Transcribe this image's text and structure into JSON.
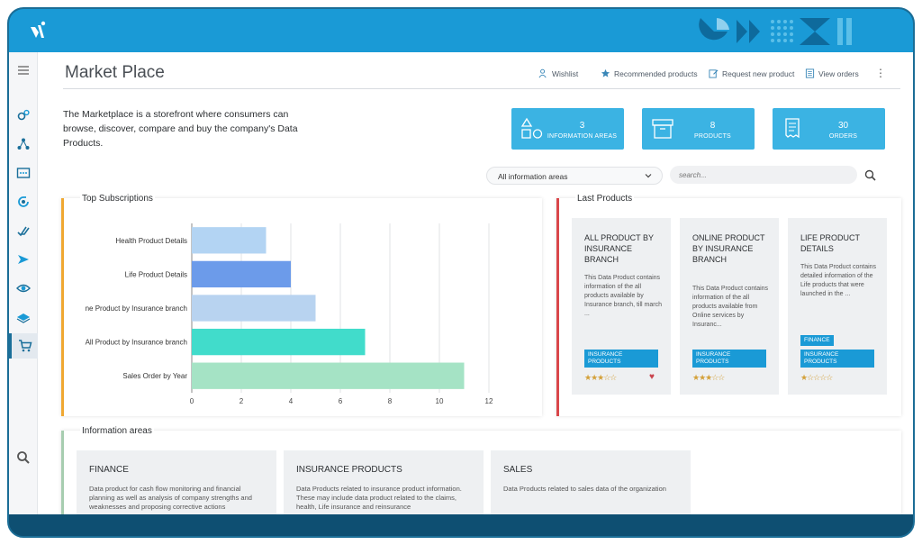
{
  "app": {
    "title": "Market Place"
  },
  "header_actions": [
    {
      "label": "Wishlist",
      "icon": "user-heart-icon"
    },
    {
      "label": "Recommended products",
      "icon": "star-icon"
    },
    {
      "label": "Request new product",
      "icon": "edit-icon"
    },
    {
      "label": "View orders",
      "icon": "list-icon"
    }
  ],
  "intro": "The Marketplace is a storefront where consumers can browse, discover, compare and buy the company's Data Products.",
  "stats": [
    {
      "value": "3",
      "label": "INFORMATION AREAS",
      "icon": "shapes-icon"
    },
    {
      "value": "8",
      "label": "PRODUCTS",
      "icon": "archive-box-icon"
    },
    {
      "value": "30",
      "label": "ORDERS",
      "icon": "receipt-icon"
    }
  ],
  "filters": {
    "select_value": "All information areas",
    "search_placeholder": "search..."
  },
  "top_subscriptions": {
    "title": "Top Subscriptions"
  },
  "chart_data": {
    "type": "bar",
    "orientation": "horizontal",
    "categories": [
      "Health Product Details",
      "Life Product Details",
      "Online Product by Insurance branch",
      "All Product by Insurance branch",
      "Sales Order by Year"
    ],
    "category_labels_shown": [
      "Health Product Details",
      "Life Product Details",
      "ne Product by Insurance branch",
      "All Product by Insurance branch",
      "Sales Order by Year"
    ],
    "values": [
      3,
      4,
      5,
      7,
      11
    ],
    "bar_colors": [
      "#b3d4f3",
      "#6c9bea",
      "#b8d3f0",
      "#41dccb",
      "#a5e3c5"
    ],
    "xlim": [
      0,
      12
    ],
    "xticks": [
      "0",
      "2",
      "4",
      "6",
      "8",
      "10",
      "12"
    ],
    "grid": "vertical",
    "title": "",
    "xlabel": "",
    "ylabel": ""
  },
  "last_products": {
    "title": "Last Products",
    "cards": [
      {
        "title": "ALL PRODUCT BY INSURANCE BRANCH",
        "desc": "This Data Product contains information of the all products available by Insurance branch, till march ...",
        "tags": [
          "INSURANCE PRODUCTS"
        ],
        "rating": "★★★☆☆",
        "wishlisted": true
      },
      {
        "title": "ONLINE PRODUCT BY INSURANCE BRANCH",
        "desc": "This Data Product contains information of the all products available from Online services by Insuranc...",
        "tags": [
          "INSURANCE PRODUCTS"
        ],
        "rating": "★★★☆☆",
        "wishlisted": false
      },
      {
        "title": "LIFE PRODUCT DETAILS",
        "desc": "This Data Product contains detailed information of the Life products that were launched in the ...",
        "tags": [
          "FINANCE",
          "INSURANCE PRODUCTS"
        ],
        "rating": "★☆☆☆☆",
        "wishlisted": false
      }
    ]
  },
  "information_areas": {
    "title": "Information areas",
    "items": [
      {
        "title": "FINANCE",
        "desc": "Data product for cash flow monitoring and financial planning as well as analysis of company strengths and weaknesses and proposing corrective actions"
      },
      {
        "title": "INSURANCE PRODUCTS",
        "desc": "Data Products related to insurance product information. These may include data product related to the claims, health, Life insurance and reinsurance"
      },
      {
        "title": "SALES",
        "desc": "Data Products related to sales data of the organization"
      }
    ]
  },
  "sidebar": {
    "items": [
      {
        "icon": "menu-icon"
      },
      {
        "icon": "gears-icon"
      },
      {
        "icon": "network-icon"
      },
      {
        "icon": "data-box-icon"
      },
      {
        "icon": "refresh-spiral-icon"
      },
      {
        "icon": "check-lines-icon"
      },
      {
        "icon": "send-icon"
      },
      {
        "icon": "eye-icon"
      },
      {
        "icon": "layers-icon"
      },
      {
        "icon": "cart-icon"
      },
      {
        "icon": "search-icon"
      }
    ]
  },
  "colors": {
    "accent": "#1a9ad6",
    "stat_bg": "#3bb3e3",
    "frame": "#0e4f72"
  }
}
